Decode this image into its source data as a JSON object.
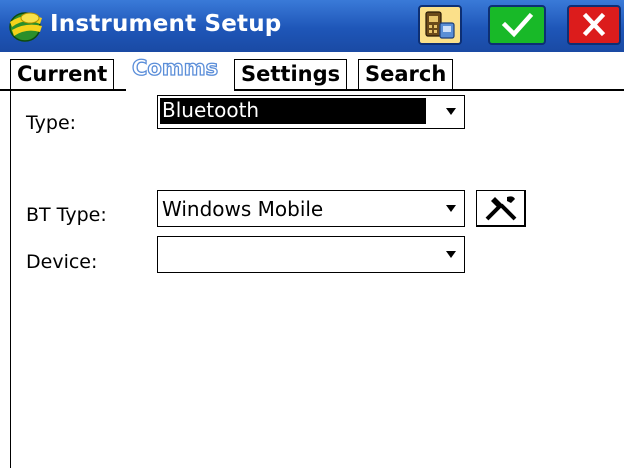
{
  "window": {
    "title": "Instrument Setup",
    "buttons": {
      "instrument_icon": "instrument-icon",
      "ok_icon": "checkmark-icon",
      "cancel_icon": "close-icon"
    },
    "colors": {
      "titlebar": "#1e56b8",
      "ok": "#18b928",
      "cancel": "#dc1c1c",
      "active_tab_text": "#5b8ed9"
    }
  },
  "tabs": [
    {
      "label": "Current",
      "active": false
    },
    {
      "label": "Comms",
      "active": true
    },
    {
      "label": "Settings",
      "active": false
    },
    {
      "label": "Search",
      "active": false
    }
  ],
  "form": {
    "type": {
      "label": "Type:",
      "value": "Bluetooth"
    },
    "bt_type": {
      "label": "BT Type:",
      "value": "Windows Mobile",
      "tool_icon": "tools-icon"
    },
    "device": {
      "label": "Device:",
      "value": ""
    }
  }
}
